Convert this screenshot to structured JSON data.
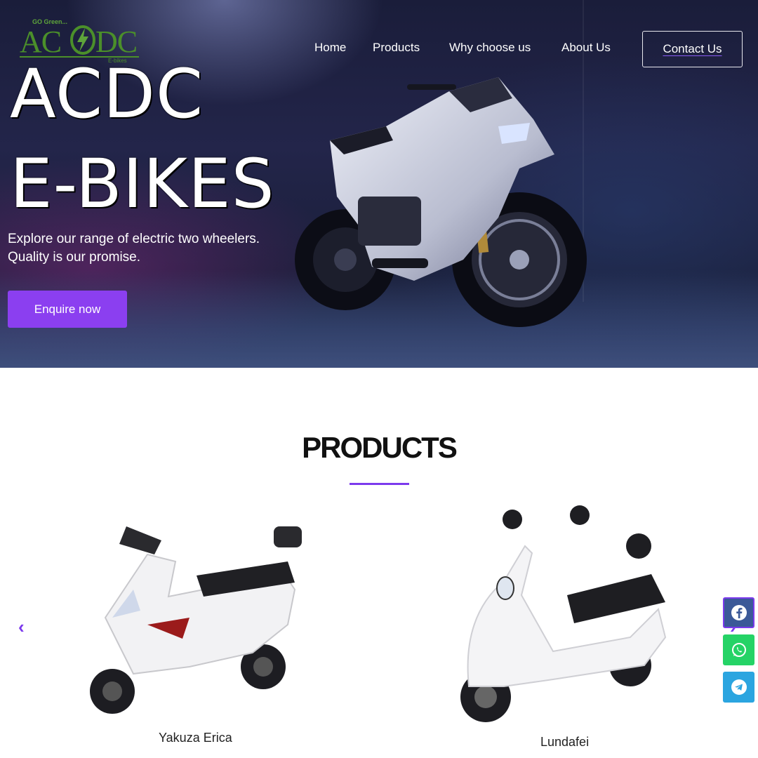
{
  "header": {
    "logo": {
      "tagline": "GO Green...",
      "left": "AC",
      "right": "DC",
      "sub": "E-bikes"
    },
    "nav": [
      {
        "label": "Home"
      },
      {
        "label": "Products"
      },
      {
        "label": "Why choose us"
      },
      {
        "label": "About Us"
      }
    ],
    "contact_label": "Contact Us"
  },
  "hero": {
    "title_line1": "ACDC",
    "title_line2": "E-BIKES",
    "description": "Explore our range of electric two wheelers. Quality is our promise.",
    "cta_label": "Enquire now"
  },
  "products": {
    "title": "PRODUCTS",
    "items": [
      {
        "name": "Yakuza Erica"
      },
      {
        "name": "Lundafei"
      }
    ],
    "prev_icon": "chevron-left-icon",
    "next_icon": "chevron-right-icon"
  },
  "social": [
    {
      "icon": "facebook-icon"
    },
    {
      "icon": "whatsapp-icon"
    },
    {
      "icon": "telegram-icon"
    }
  ],
  "colors": {
    "accent": "#8b3ff0",
    "logo_green": "#4b8f2a"
  }
}
